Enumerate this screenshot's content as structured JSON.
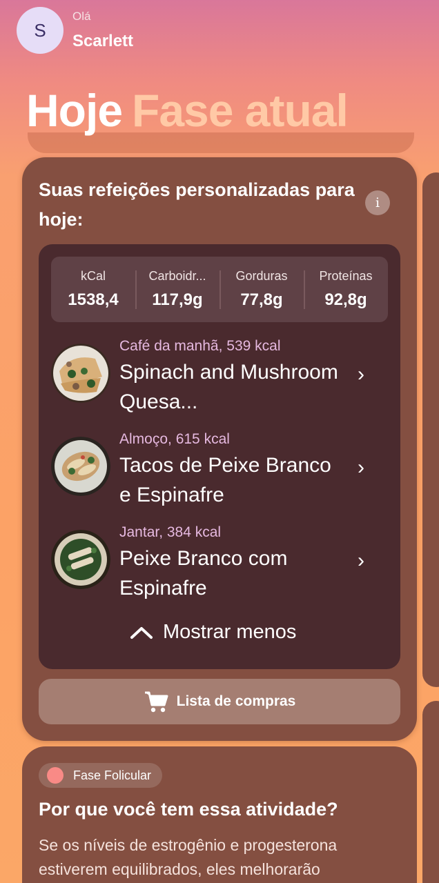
{
  "header": {
    "avatar_initial": "S",
    "greeting": "Olá",
    "user_name": "Scarlett"
  },
  "title": {
    "today": "Hoje",
    "phase": "Fase atual"
  },
  "meals_card": {
    "title": "Suas refeições personalizadas para hoje:",
    "info_icon": "info-icon",
    "macros": [
      {
        "label": "kCal",
        "value": "1538,4"
      },
      {
        "label": "Carboidr...",
        "value": "117,9g"
      },
      {
        "label": "Gorduras",
        "value": "77,8g"
      },
      {
        "label": "Proteínas",
        "value": "92,8g"
      }
    ],
    "meals": [
      {
        "meta": "Café da manhã, 539 kcal",
        "name": "Spinach and Mushroom Quesa..."
      },
      {
        "meta": "Almoço, 615 kcal",
        "name": "Tacos de Peixe Branco e Espinafre"
      },
      {
        "meta": "Jantar, 384 kcal",
        "name": "Peixe Branco com Espinafre"
      }
    ],
    "toggle_label": "Mostrar menos",
    "shopping_label": "Lista de compras"
  },
  "phase_card": {
    "phase_name": "Fase Folicular",
    "phase_color": "#f98a86",
    "title": "Por que você tem essa atividade?",
    "body": "Se os níveis de estrogênio e progesterona estiverem equilibrados, eles melhorarão"
  }
}
